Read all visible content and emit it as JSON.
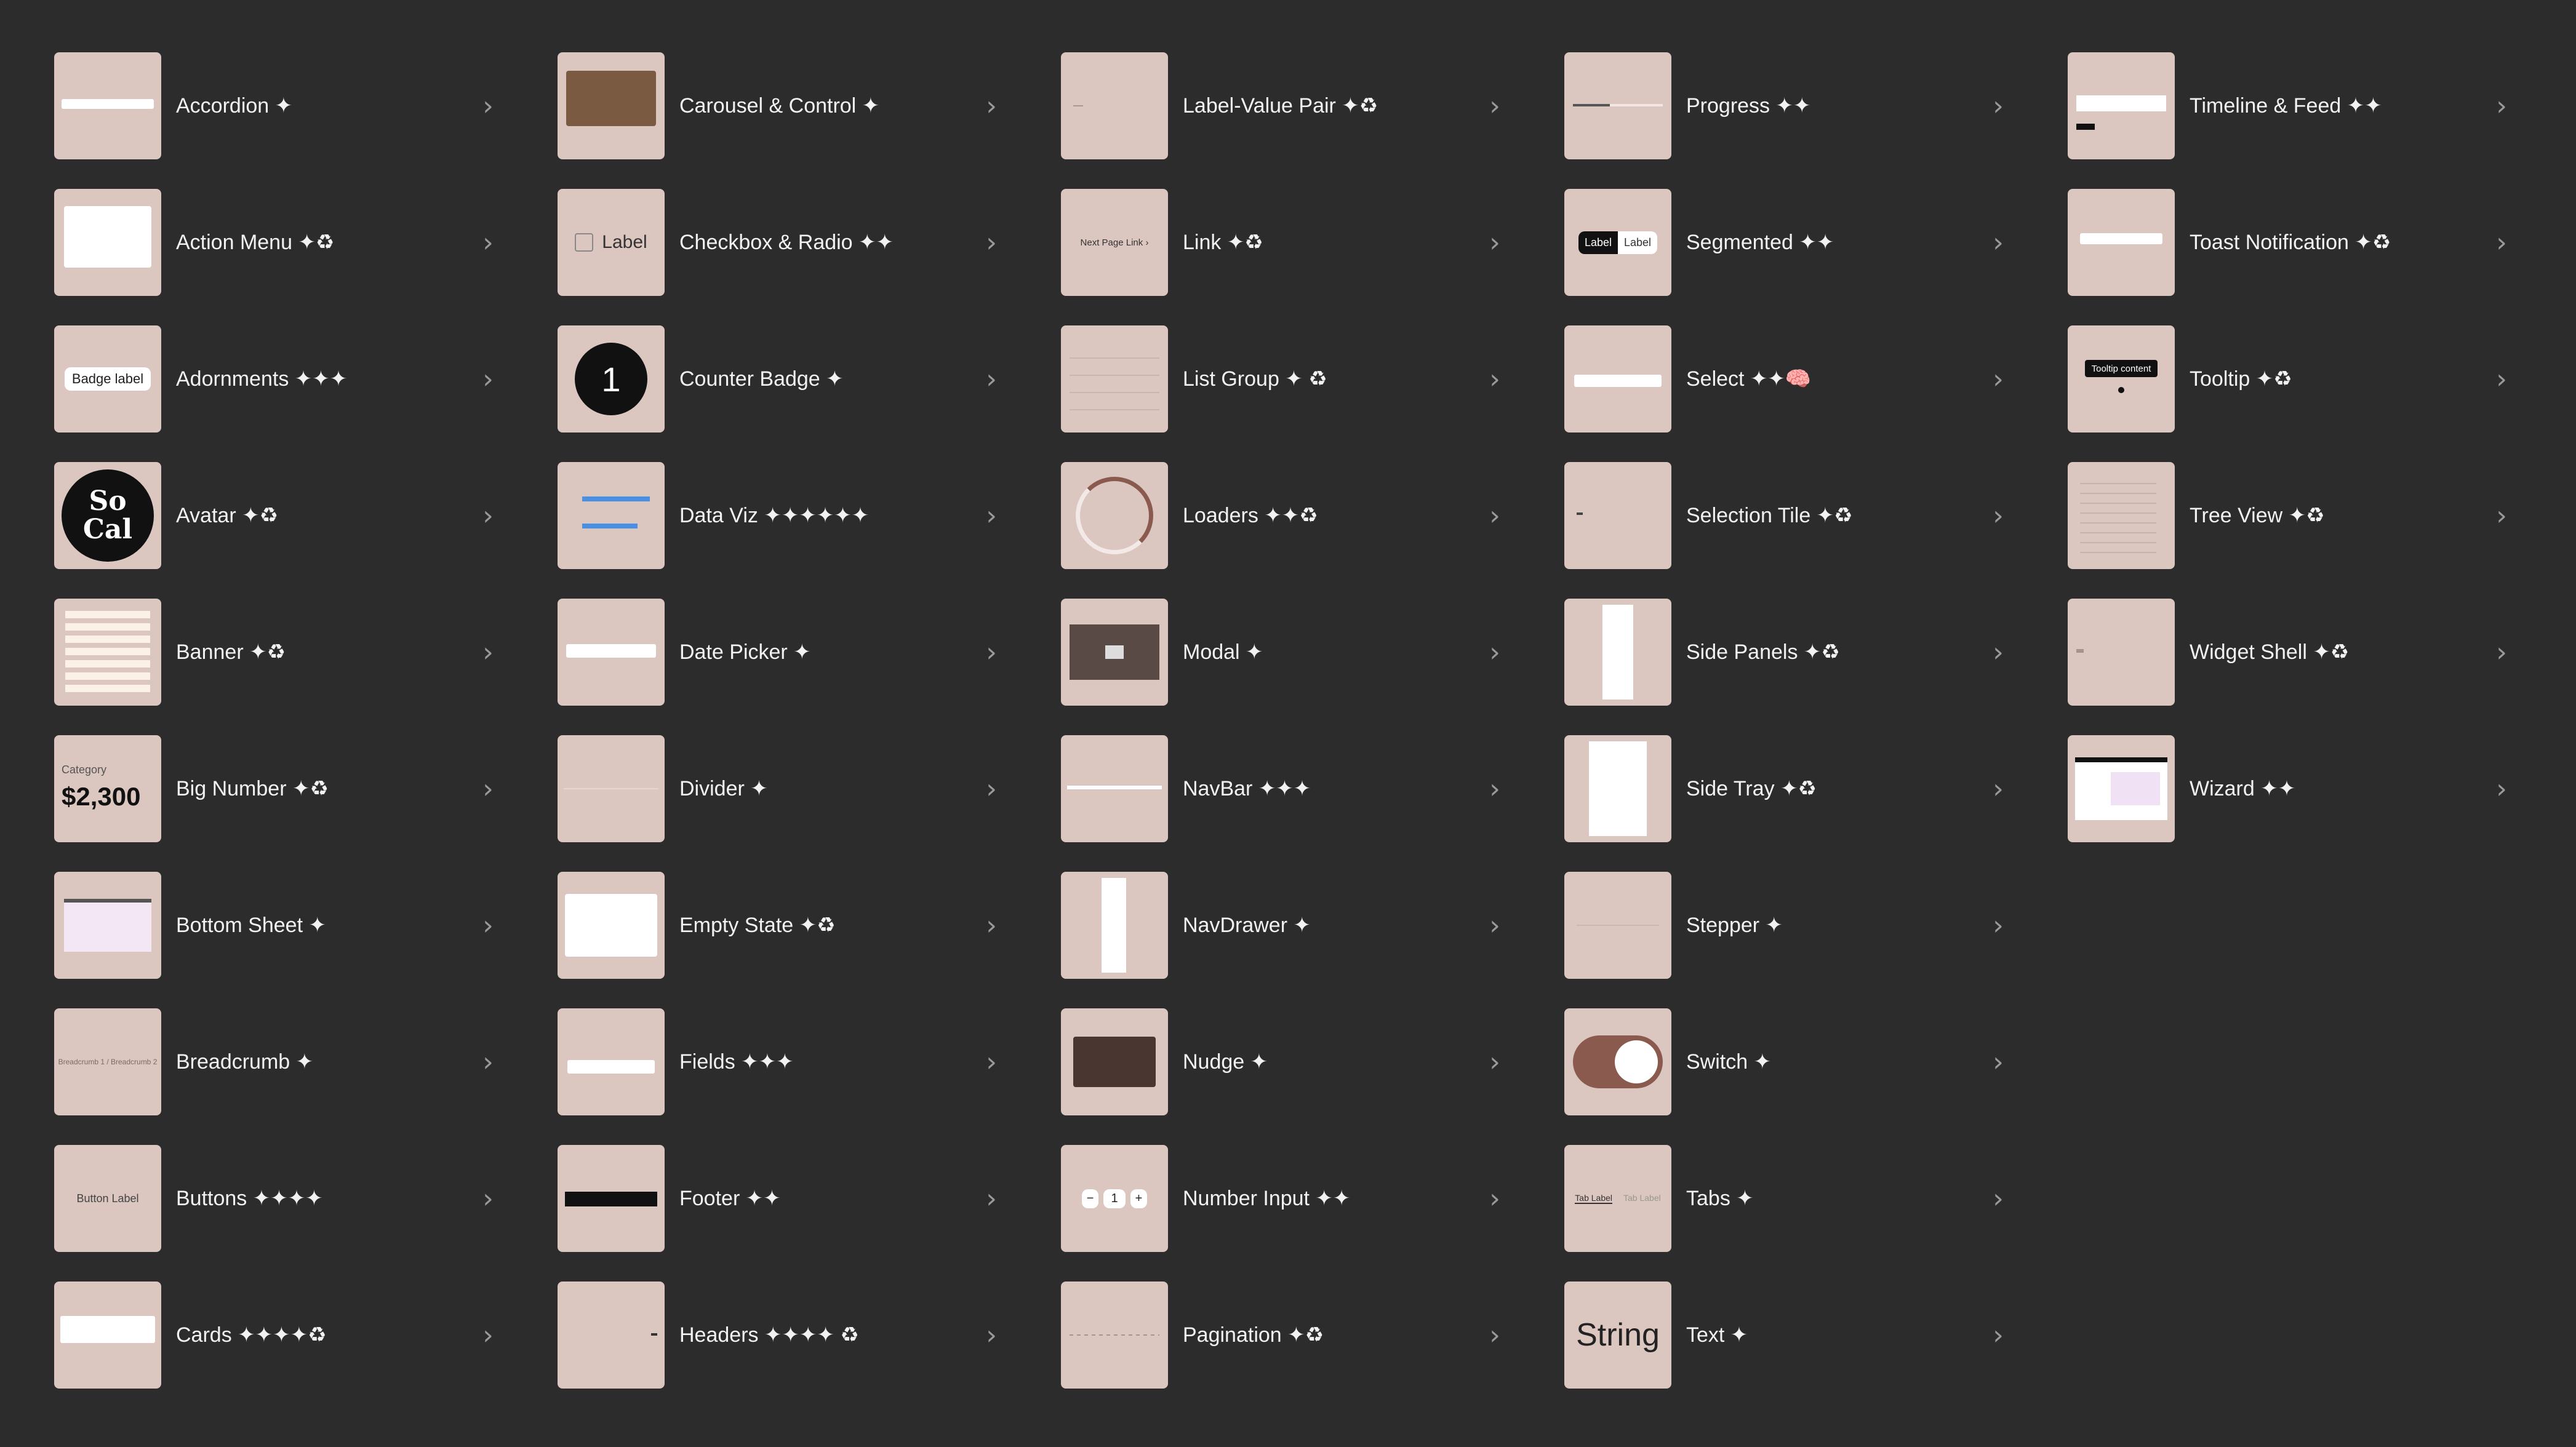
{
  "components": [
    {
      "name": "Accordion ✦",
      "slug": "accordion"
    },
    {
      "name": "Action Menu ✦♻",
      "slug": "action-menu"
    },
    {
      "name": "Adornments ✦✦✦",
      "slug": "adornments",
      "thumb_text": "Badge label"
    },
    {
      "name": "Avatar ✦♻",
      "slug": "avatar",
      "thumb_text": "So Cal"
    },
    {
      "name": "Banner ✦♻",
      "slug": "banner"
    },
    {
      "name": "Big Number ✦♻",
      "slug": "big-number",
      "thumb_text": "$2,300",
      "thumb_sub": "Category"
    },
    {
      "name": "Bottom Sheet ✦",
      "slug": "bottom-sheet"
    },
    {
      "name": "Breadcrumb ✦",
      "slug": "breadcrumb",
      "thumb_text": "Breadcrumb 1 / Breadcrumb 2"
    },
    {
      "name": "Buttons ✦✦✦✦",
      "slug": "buttons",
      "thumb_text": "Button Label"
    },
    {
      "name": "Cards ✦✦✦✦♻",
      "slug": "cards"
    },
    {
      "name": "Carousel & Control ✦",
      "slug": "carousel-control"
    },
    {
      "name": "Checkbox & Radio ✦✦",
      "slug": "checkbox-radio",
      "thumb_text": "Label"
    },
    {
      "name": "Counter Badge ✦",
      "slug": "counter-badge",
      "thumb_text": "1"
    },
    {
      "name": "Data Viz ✦✦✦✦✦✦",
      "slug": "data-viz"
    },
    {
      "name": "Date Picker ✦",
      "slug": "date-picker"
    },
    {
      "name": "Divider ✦",
      "slug": "divider"
    },
    {
      "name": "Empty State ✦♻",
      "slug": "empty-state"
    },
    {
      "name": "Fields ✦✦✦",
      "slug": "fields"
    },
    {
      "name": "Footer ✦✦",
      "slug": "footer"
    },
    {
      "name": "Headers ✦✦✦✦ ♻",
      "slug": "headers"
    },
    {
      "name": "Label-Value Pair ✦♻",
      "slug": "label-value-pair"
    },
    {
      "name": "Link ✦♻",
      "slug": "link",
      "thumb_text": "Next Page Link ›"
    },
    {
      "name": "List Group ✦ ♻",
      "slug": "list-group"
    },
    {
      "name": "Loaders ✦✦♻",
      "slug": "loaders"
    },
    {
      "name": "Modal ✦",
      "slug": "modal"
    },
    {
      "name": "NavBar ✦✦✦",
      "slug": "navbar"
    },
    {
      "name": "NavDrawer ✦",
      "slug": "navdrawer"
    },
    {
      "name": "Nudge ✦",
      "slug": "nudge"
    },
    {
      "name": "Number Input ✦✦",
      "slug": "number-input",
      "thumb_text": "1"
    },
    {
      "name": "Pagination ✦♻",
      "slug": "pagination"
    },
    {
      "name": "Progress ✦✦",
      "slug": "progress"
    },
    {
      "name": "Segmented ✦✦",
      "slug": "segmented",
      "thumb_text": "Label"
    },
    {
      "name": "Select ✦✦🧠",
      "slug": "select"
    },
    {
      "name": "Selection Tile ✦♻",
      "slug": "selection-tile"
    },
    {
      "name": "Side Panels ✦♻",
      "slug": "side-panels"
    },
    {
      "name": "Side Tray ✦♻",
      "slug": "side-tray"
    },
    {
      "name": "Stepper ✦",
      "slug": "stepper"
    },
    {
      "name": "Switch ✦",
      "slug": "switch"
    },
    {
      "name": "Tabs ✦",
      "slug": "tabs",
      "thumb_text": "Tab Label"
    },
    {
      "name": "Text ✦",
      "slug": "text",
      "thumb_text": "String"
    },
    {
      "name": "Timeline & Feed ✦✦",
      "slug": "timeline-feed"
    },
    {
      "name": "Toast Notification ✦♻",
      "slug": "toast-notification"
    },
    {
      "name": "Tooltip ✦♻",
      "slug": "tooltip",
      "thumb_text": "Tooltip content"
    },
    {
      "name": "Tree View ✦♻",
      "slug": "tree-view"
    },
    {
      "name": "Widget Shell ✦♻",
      "slug": "widget-shell"
    },
    {
      "name": "Wizard ✦✦",
      "slug": "wizard"
    }
  ],
  "chevron": "›",
  "colors": {
    "background": "#2c2c2c",
    "thumb": "#dcc6c0",
    "brown": "#8a5a4e",
    "text": "#f2f2f2",
    "chevron": "#9a9a9a"
  }
}
